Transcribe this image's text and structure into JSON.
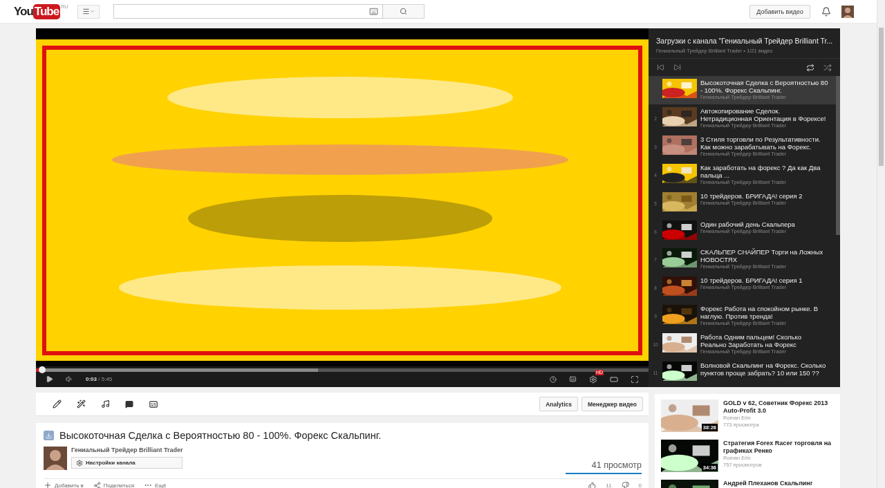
{
  "header": {
    "logo": {
      "you": "You",
      "tube": "Tube",
      "region": "RU"
    },
    "upload_button": "Добавить видео"
  },
  "player": {
    "progress": {
      "level": 0.01
    },
    "buffer": {
      "level": 0.46
    },
    "time_current": "0:03",
    "time_total": "/ 5:45",
    "hd_badge": "HD"
  },
  "playlist": {
    "title": "Загрузки с канала \"Гениальный Трейдер Brilliant Tr...",
    "subtitle": "Гениальный Трейдер Brilliant Trader • 1/21 видео",
    "items": [
      {
        "selected": true,
        "title": "Высокоточная Сделка с Вероятностью 80 - 100%. Форекс Скальпинг.",
        "channel": "Гениальный Трейдер Brilliant Trader"
      },
      {
        "selected": false,
        "index": "2",
        "title": "Автокопирование Сделок. Нетрадиционная Ориентация в Форексе!",
        "channel": "Гениальный Трейдер Brilliant Trader"
      },
      {
        "selected": false,
        "index": "3",
        "title": "3 Стиля торговли по Результативности. Как можно зарабатывать на Форекс.",
        "channel": "Гениальный Трейдер Brilliant Trader"
      },
      {
        "selected": false,
        "index": "4",
        "title": "Как заработать на форекс ? Да как Два пальца ...",
        "channel": "Гениальный Трейдер Brilliant Trader"
      },
      {
        "selected": false,
        "index": "5",
        "title": "10 трейдеров. БРИГАДА! серия 2",
        "channel": "Гениальный Трейдер Brilliant Trader"
      },
      {
        "selected": false,
        "index": "6",
        "title": "Один рабочий день Скальпера",
        "channel": "Гениальный Трейдер Brilliant Trader"
      },
      {
        "selected": false,
        "index": "7",
        "title": "СКАЛЬПЕР СНАЙПЕР Торги на Ложных НОВОСТЯХ",
        "channel": "Гениальный Трейдер Brilliant Trader"
      },
      {
        "selected": false,
        "index": "8",
        "title": "10 трейдеров. БРИГАДА! серия 1",
        "channel": "Гениальный Трейдер Brilliant Trader"
      },
      {
        "selected": false,
        "index": "9",
        "title": "Форекс Работа на спокойном рынке. В наглую. Против тренда!",
        "channel": "Гениальный Трейдер Brilliant Trader"
      },
      {
        "selected": false,
        "index": "10",
        "title": "Работа Одним пальцем! Сколько Реально Заработать на Форекс",
        "channel": "Гениальный Трейдер Brilliant Trader"
      },
      {
        "selected": false,
        "index": "11",
        "title": "Волновой Скальпинг на Форекс. Сколько пунктов проще забрать? 10 или 150 ??"
      }
    ]
  },
  "toolbar": {
    "buttons": [
      "Analytics",
      "Менеджер видео"
    ]
  },
  "video": {
    "title": "Высокоточная Сделка с Вероятностью 80 - 100%. Форекс Скальпинг.",
    "channel": "Гениальный Трейдер Brilliant Trader",
    "settings_button": "Настройки канала",
    "views": "41 просмотр",
    "actions": [
      {
        "kind": "add",
        "label": "Добавить в"
      },
      {
        "kind": "share",
        "label": "Поделиться"
      },
      {
        "kind": "more",
        "label": "Ещё"
      }
    ],
    "likes": "11",
    "dislikes": "0"
  },
  "suggestions": [
    {
      "title": "GOLD v 62, Советник Форекс 2013 Auto-Profit 3.0",
      "author": "Roman Erin",
      "views": "773 просмотра",
      "duration": "38:26"
    },
    {
      "title": "Стратегия Forex Racer торговля на графиках Ренко",
      "author": "Roman Erin",
      "views": "757 просмотров",
      "duration": "34:36"
    },
    {
      "title": "Андрей Плеханов Скальпинг"
    }
  ]
}
